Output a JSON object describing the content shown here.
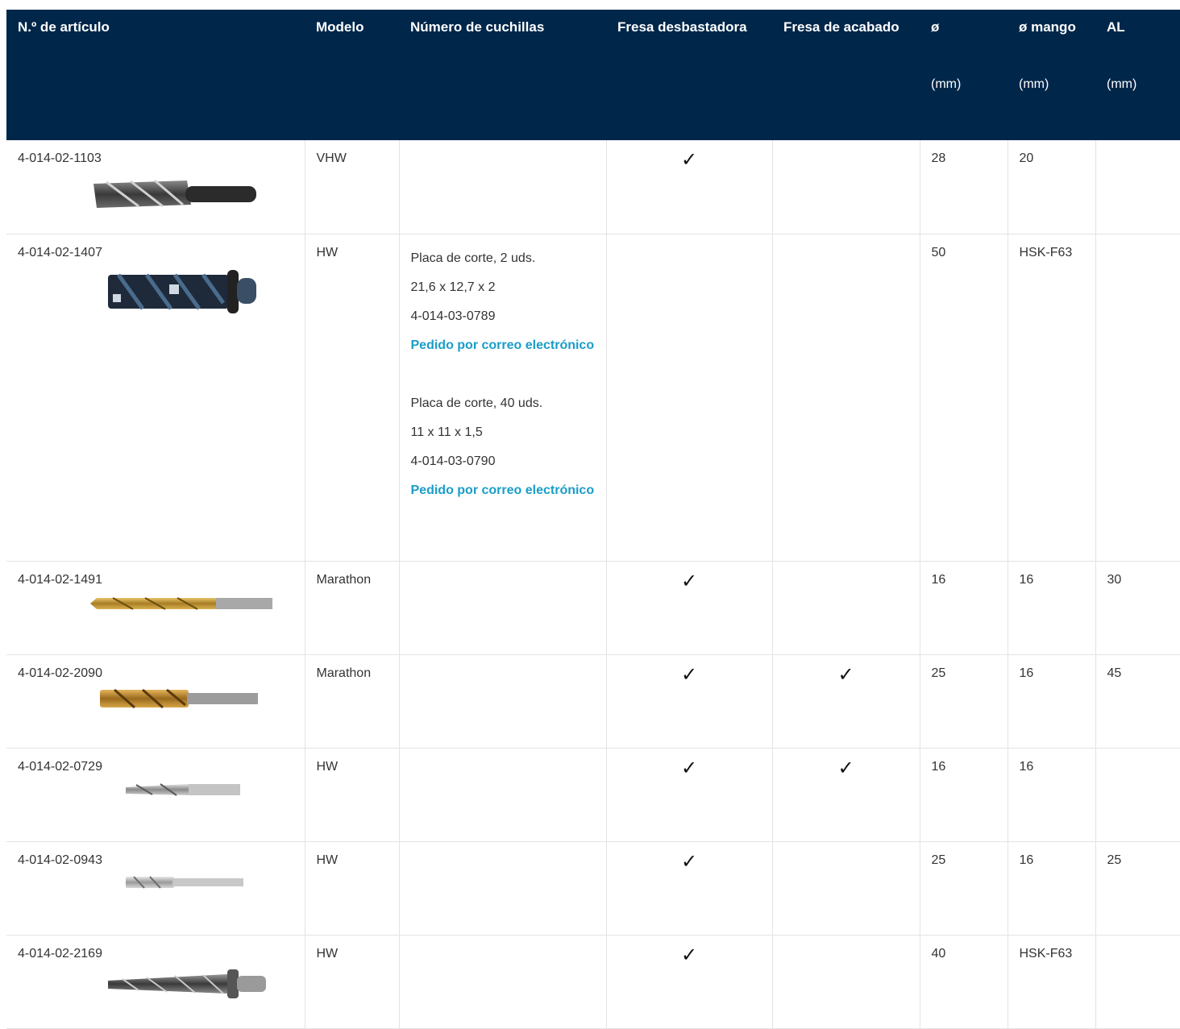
{
  "colors": {
    "header_bg": "#00264a",
    "header_text": "#ffffff",
    "link": "#1a9dc7",
    "grid": "#e3e3e3"
  },
  "headers": {
    "article": "N.º de artículo",
    "model": "Modelo",
    "blades": "Número de cuchillas",
    "rough": "Fresa desbastadora",
    "finish": "Fresa de acabado",
    "dia": "ø",
    "dia_unit": "(mm)",
    "shank": "ø mango",
    "shank_unit": "(mm)",
    "al": "AL",
    "al_unit": "(mm)"
  },
  "check_mark": "✓",
  "rows": [
    {
      "article": "4-014-02-1103",
      "model": "VHW",
      "rough": true,
      "finish": false,
      "dia": "28",
      "shank": "20",
      "al": "",
      "image_icon": "milling-cutter-dark-icon"
    },
    {
      "article": "4-014-02-1407",
      "model": "HW",
      "rough": false,
      "finish": false,
      "dia": "50",
      "shank": "HSK-F63",
      "al": "",
      "image_icon": "indexable-cutter-icon",
      "inserts": [
        {
          "name": "Placa de corte, 2 uds.",
          "size": "21,6 x 12,7 x 2",
          "code": "4-014-03-0789",
          "order": "Pedido por correo electrónico"
        },
        {
          "name": "Placa de corte, 40 uds.",
          "size": "11 x 11 x 1,5",
          "code": "4-014-03-0790",
          "order": "Pedido por correo electrónico"
        }
      ]
    },
    {
      "article": "4-014-02-1491",
      "model": "Marathon",
      "rough": true,
      "finish": false,
      "dia": "16",
      "shank": "16",
      "al": "30",
      "image_icon": "gold-drill-icon"
    },
    {
      "article": "4-014-02-2090",
      "model": "Marathon",
      "rough": true,
      "finish": true,
      "dia": "25",
      "shank": "16",
      "al": "45",
      "image_icon": "gold-cutter-icon"
    },
    {
      "article": "4-014-02-0729",
      "model": "HW",
      "rough": true,
      "finish": true,
      "dia": "16",
      "shank": "16",
      "al": "",
      "image_icon": "silver-drill-icon"
    },
    {
      "article": "4-014-02-0943",
      "model": "HW",
      "rough": true,
      "finish": false,
      "dia": "25",
      "shank": "16",
      "al": "25",
      "image_icon": "silver-cutter-icon"
    },
    {
      "article": "4-014-02-2169",
      "model": "HW",
      "rough": true,
      "finish": false,
      "dia": "40",
      "shank": "HSK-F63",
      "al": "",
      "image_icon": "hsk-cutter-icon"
    }
  ]
}
